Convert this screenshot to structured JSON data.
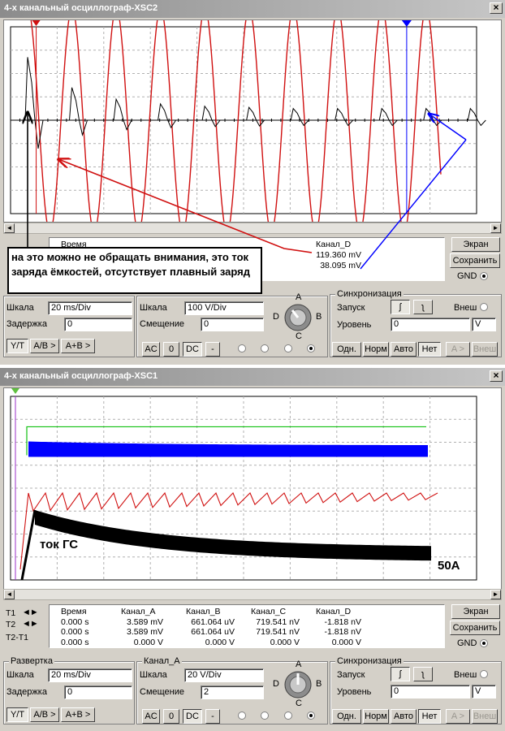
{
  "colors": {
    "red": "#d01010",
    "blue": "#0000ff",
    "green": "#10c010",
    "black": "#000000"
  },
  "osc2": {
    "title": "4-х канальный осциллограф-XSC2",
    "meas": {
      "time_header": "Время",
      "ch_d_header": "Канал_D",
      "ch_d_t1": "119.360 mV",
      "ch_d_t2": "38.095 mV"
    },
    "buttons": {
      "screen": "Экран",
      "save": "Сохранить",
      "gnd": "GND"
    },
    "timebase": {
      "scale_label": "Шкала",
      "scale": "20 ms/Div",
      "delay_label": "Задержка",
      "delay": "0"
    },
    "mode_buttons": [
      "Y/T",
      "A/B >",
      "A+B >"
    ],
    "channel": {
      "scale_label": "Шкала",
      "scale": "100  V/Div",
      "offset_label": "Смещение",
      "offset": "0"
    },
    "coupling": [
      "AC",
      "0",
      "DC",
      "-"
    ],
    "knob": {
      "a": "A",
      "b": "B",
      "c": "C",
      "d": "D"
    },
    "sync": {
      "title": "Синхронизация",
      "trigger_label": "Запуск",
      "ext_label": "Внеш",
      "level_label": "Уровень",
      "level": "0",
      "unit": "V",
      "modes": [
        "Одн.",
        "Норм",
        "Авто",
        "Нет"
      ],
      "a_ext": [
        "A >",
        "Внеш"
      ]
    },
    "annotation": "на это можно не обращать внимания, это ток заряда ёмкостей, отсутствует плавный заряд"
  },
  "osc1": {
    "title": "4-х канальный осциллограф-XSC1",
    "t_labels": [
      "T1",
      "T2",
      "T2-T1"
    ],
    "meas": {
      "headers": [
        "Время",
        "Канал_A",
        "Канал_B",
        "Канал_C",
        "Канал_D"
      ],
      "rows": [
        [
          "0.000 s",
          "3.589 mV",
          "661.064 uV",
          "719.541 nV",
          "-1.818 nV"
        ],
        [
          "0.000 s",
          "3.589 mV",
          "661.064 uV",
          "719.541 nV",
          "-1.818 nV"
        ],
        [
          "0.000 s",
          "0.000 V",
          "0.000 V",
          "0.000 V",
          "0.000 V"
        ]
      ]
    },
    "buttons": {
      "screen": "Экран",
      "save": "Сохранить",
      "gnd": "GND"
    },
    "timebase": {
      "title": "Развертка",
      "scale_label": "Шкала",
      "scale": "20 ms/Div",
      "delay_label": "Задержка",
      "delay": "0"
    },
    "mode_buttons": [
      "Y/T",
      "A/B >",
      "A+B >"
    ],
    "channel": {
      "title": "Канал_A",
      "scale_label": "Шкала",
      "scale": "20  V/Div",
      "offset_label": "Смещение",
      "offset": "2"
    },
    "coupling": [
      "AC",
      "0",
      "DC",
      "-"
    ],
    "knob": {
      "a": "A",
      "b": "B",
      "c": "C",
      "d": "D"
    },
    "sync": {
      "title": "Синхронизация",
      "trigger_label": "Запуск",
      "ext_label": "Внеш",
      "level_label": "Уровень",
      "level": "0",
      "unit": "V",
      "modes": [
        "Одн.",
        "Норм",
        "Авто",
        "Нет"
      ],
      "a_ext": [
        "A >",
        "Внеш"
      ]
    },
    "label_current": "ток ГС",
    "label_50a": "50A"
  },
  "chart_data": [
    {
      "type": "line",
      "series": [
        {
          "values_desc": "sine",
          "amplitude_div": 4.8,
          "period_div": 0.95
        },
        {
          "values_desc": "pulses",
          "pulse_heights_div": [
            2.7,
            1.4,
            0.9,
            0.7,
            0.6,
            0.55,
            0.5,
            0.5,
            0.5,
            0.5,
            0.5,
            0.5,
            0.5
          ]
        }
      ],
      "x_divisions": 10,
      "y_divisions": 8,
      "cursor_t1_div": 0.55,
      "cursor_t2_div": 8.5
    },
    {
      "type": "line",
      "series": [
        {
          "values_desc": "green-step",
          "level_div": 1.1
        },
        {
          "values_desc": "blue-band",
          "start_div": 0.6,
          "decay_to_div": 0.5
        },
        {
          "values_desc": "red-sawtooth",
          "level_div": -0.2
        },
        {
          "values_desc": "black-band",
          "peak_div": -0.4,
          "final_div": -1.5
        }
      ],
      "x_divisions": 10,
      "y_divisions": 8
    }
  ]
}
